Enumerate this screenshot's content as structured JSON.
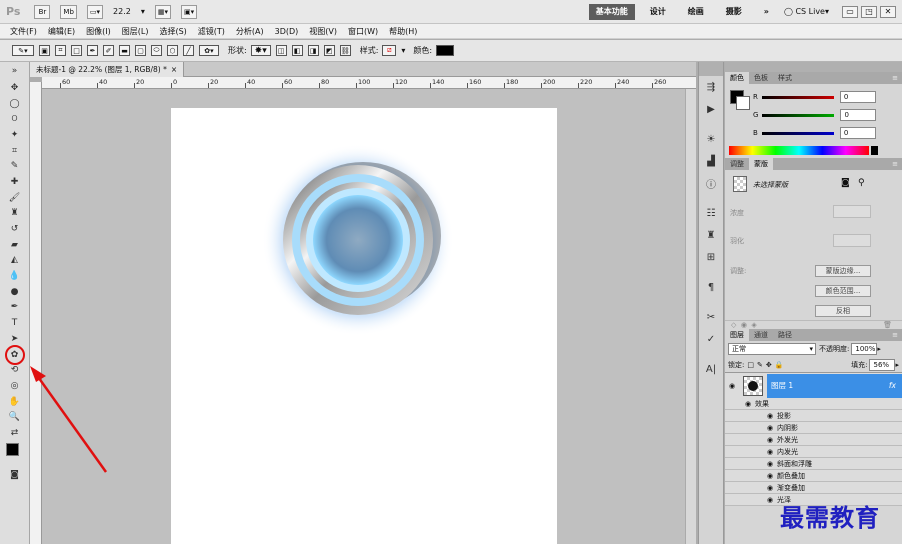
{
  "app": {
    "logo": "Ps"
  },
  "topbar": {
    "zoom": "22.2",
    "workspaces": [
      "基本功能",
      "设计",
      "绘画",
      "摄影"
    ],
    "more": "»",
    "cslive": "CS Live▾"
  },
  "menu": [
    "文件(F)",
    "编辑(E)",
    "图像(I)",
    "图层(L)",
    "选择(S)",
    "滤镜(T)",
    "分析(A)",
    "3D(D)",
    "视图(V)",
    "窗口(W)",
    "帮助(H)"
  ],
  "options": {
    "shape_label": "形状:",
    "style_label": "样式:",
    "color_label": "颜色:"
  },
  "document": {
    "tab_title": "未标题-1 @ 22.2% (图层 1, RGB/8) *",
    "close": "×",
    "ruler_labels": [
      "60",
      "40",
      "20",
      "0",
      "20",
      "40",
      "60",
      "80",
      "100",
      "120",
      "140",
      "160",
      "180",
      "200",
      "220",
      "240",
      "260"
    ]
  },
  "color_panel": {
    "tabs": [
      "颜色",
      "色板",
      "样式"
    ],
    "channels": [
      {
        "label": "R",
        "value": "0",
        "grad_color": "#cc0000"
      },
      {
        "label": "G",
        "value": "0",
        "grad_color": "#00aa00"
      },
      {
        "label": "B",
        "value": "0",
        "grad_color": "#0000cc"
      }
    ]
  },
  "adjust_panel": {
    "tabs": [
      "调整",
      "蒙版"
    ],
    "no_mask": "未选择蒙版",
    "density": "浓度",
    "feather": "羽化",
    "refine": "调整:",
    "mask_edge": "蒙版边缘...",
    "color_range": "颜色范围...",
    "invert": "反相"
  },
  "layers_panel": {
    "tabs": [
      "图层",
      "通道",
      "路径"
    ],
    "blend_mode": "正常",
    "opacity_label": "不透明度:",
    "opacity": "100%",
    "lock_label": "锁定:",
    "fill_label": "填充:",
    "fill": "56%",
    "layer_name": "图层 1",
    "fx": "fx",
    "effects_label": "效果",
    "effects": [
      "投影",
      "内阴影",
      "外发光",
      "内发光",
      "斜面和浮雕",
      "颜色叠加",
      "渐变叠加",
      "光泽"
    ]
  },
  "watermark": "最需教育"
}
